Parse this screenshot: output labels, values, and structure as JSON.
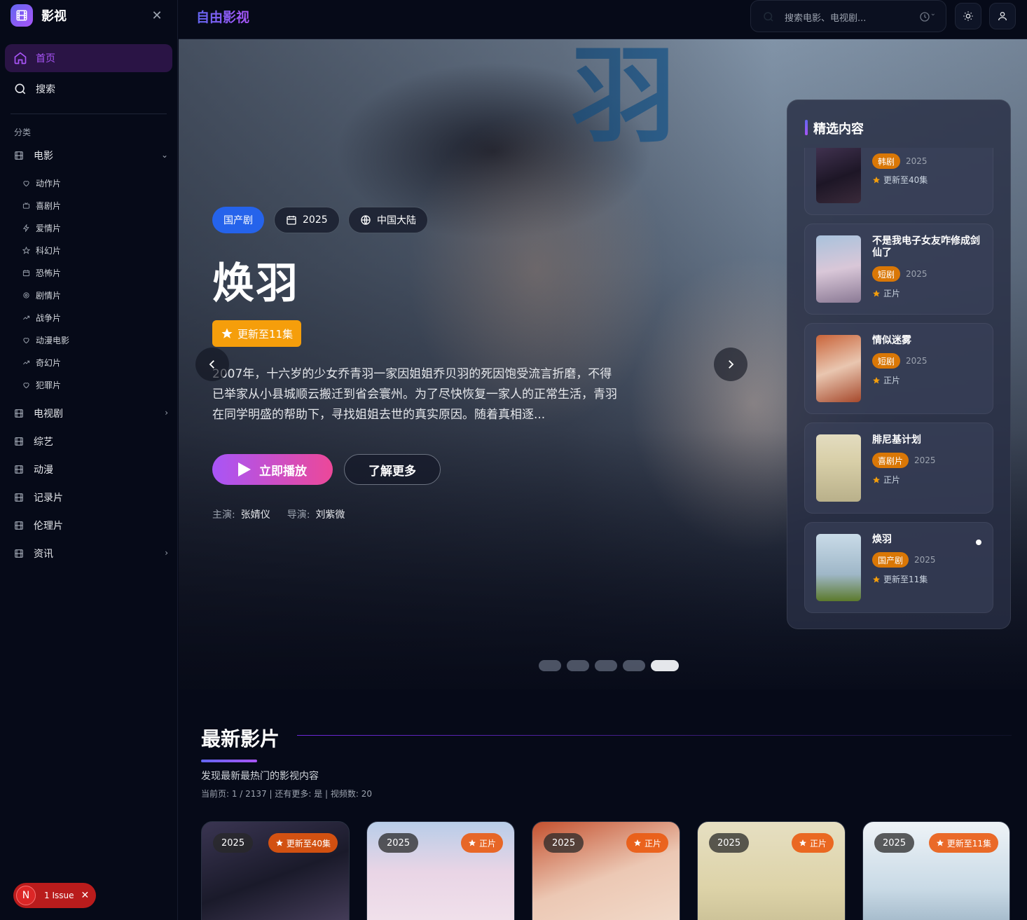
{
  "brand": {
    "name": "影视"
  },
  "nav": {
    "home": "首页",
    "search": "搜索"
  },
  "categories_label": "分类",
  "categories": [
    {
      "label": "电影",
      "chevron": "⌄",
      "subs": [
        "动作片",
        "喜剧片",
        "爱情片",
        "科幻片",
        "恐怖片",
        "剧情片",
        "战争片",
        "动漫电影",
        "奇幻片",
        "犯罪片"
      ]
    },
    {
      "label": "电视剧",
      "chevron": "›"
    },
    {
      "label": "综艺",
      "chevron": ""
    },
    {
      "label": "动漫",
      "chevron": ""
    },
    {
      "label": "记录片",
      "chevron": ""
    },
    {
      "label": "伦理片",
      "chevron": ""
    },
    {
      "label": "资讯",
      "chevron": "›"
    }
  ],
  "issue": {
    "letter": "N",
    "text": "1 Issue"
  },
  "header": {
    "site_title": "自由影视",
    "search_placeholder": "搜索电影、电视剧..."
  },
  "hero": {
    "genre": "国产剧",
    "year": "2025",
    "region": "中国大陆",
    "title": "焕羽",
    "badge": "更新至11集",
    "description": "2007年，十六岁的少女乔青羽一家因姐姐乔贝羽的死因饱受流言折磨，不得已举家从小县城顺云搬迁到省会寰州。为了尽快恢复一家人的正常生活，青羽在同学明盛的帮助下，寻找姐姐去世的真实原因。随着真相逐...",
    "play_label": "立即播放",
    "more_label": "了解更多",
    "cast_label": "主演:",
    "cast": "张婧仪",
    "director_label": "导演:",
    "director": "刘紫微",
    "poster_char": "羽",
    "slide_count": 5,
    "active_slide": 5
  },
  "featured": {
    "title": "精选内容",
    "items": [
      {
        "name": "",
        "tag": "韩剧",
        "year": "2025",
        "status": "更新至40集"
      },
      {
        "name": "不是我电子女友咋修成剑仙了",
        "tag": "短剧",
        "year": "2025",
        "status": "正片"
      },
      {
        "name": "情似迷雾",
        "tag": "短剧",
        "year": "2025",
        "status": "正片"
      },
      {
        "name": "腓尼基计划",
        "tag": "喜剧片",
        "year": "2025",
        "status": "正片"
      },
      {
        "name": "焕羽",
        "tag": "国产剧",
        "year": "2025",
        "status": "更新至11集",
        "active": true
      }
    ]
  },
  "latest": {
    "title": "最新影片",
    "subtitle": "发现最新最热门的影视内容",
    "info": "当前页: 1 / 2137 | 还有更多: 是 | 视频数: 20",
    "cards": [
      {
        "year": "2025",
        "badge": "更新至40集"
      },
      {
        "year": "2025",
        "badge": "正片"
      },
      {
        "year": "2025",
        "badge": "正片"
      },
      {
        "year": "2025",
        "badge": "正片"
      },
      {
        "year": "2025",
        "badge": "更新至11集"
      }
    ]
  },
  "colors": {
    "accent": "#a855f7",
    "accent_blue": "#6366f1",
    "badge_orange": "#f59e0b",
    "genre_blue": "#2563eb"
  },
  "icons": [
    "film-icon",
    "close-icon",
    "home-icon",
    "search-icon",
    "heart-icon",
    "tv-icon",
    "zap-icon",
    "star-icon",
    "calendar-icon",
    "gear-icon",
    "trend-icon",
    "clock-icon",
    "sun-icon",
    "user-icon",
    "globe-icon",
    "play-icon",
    "chevron-left-icon",
    "chevron-right-icon"
  ]
}
